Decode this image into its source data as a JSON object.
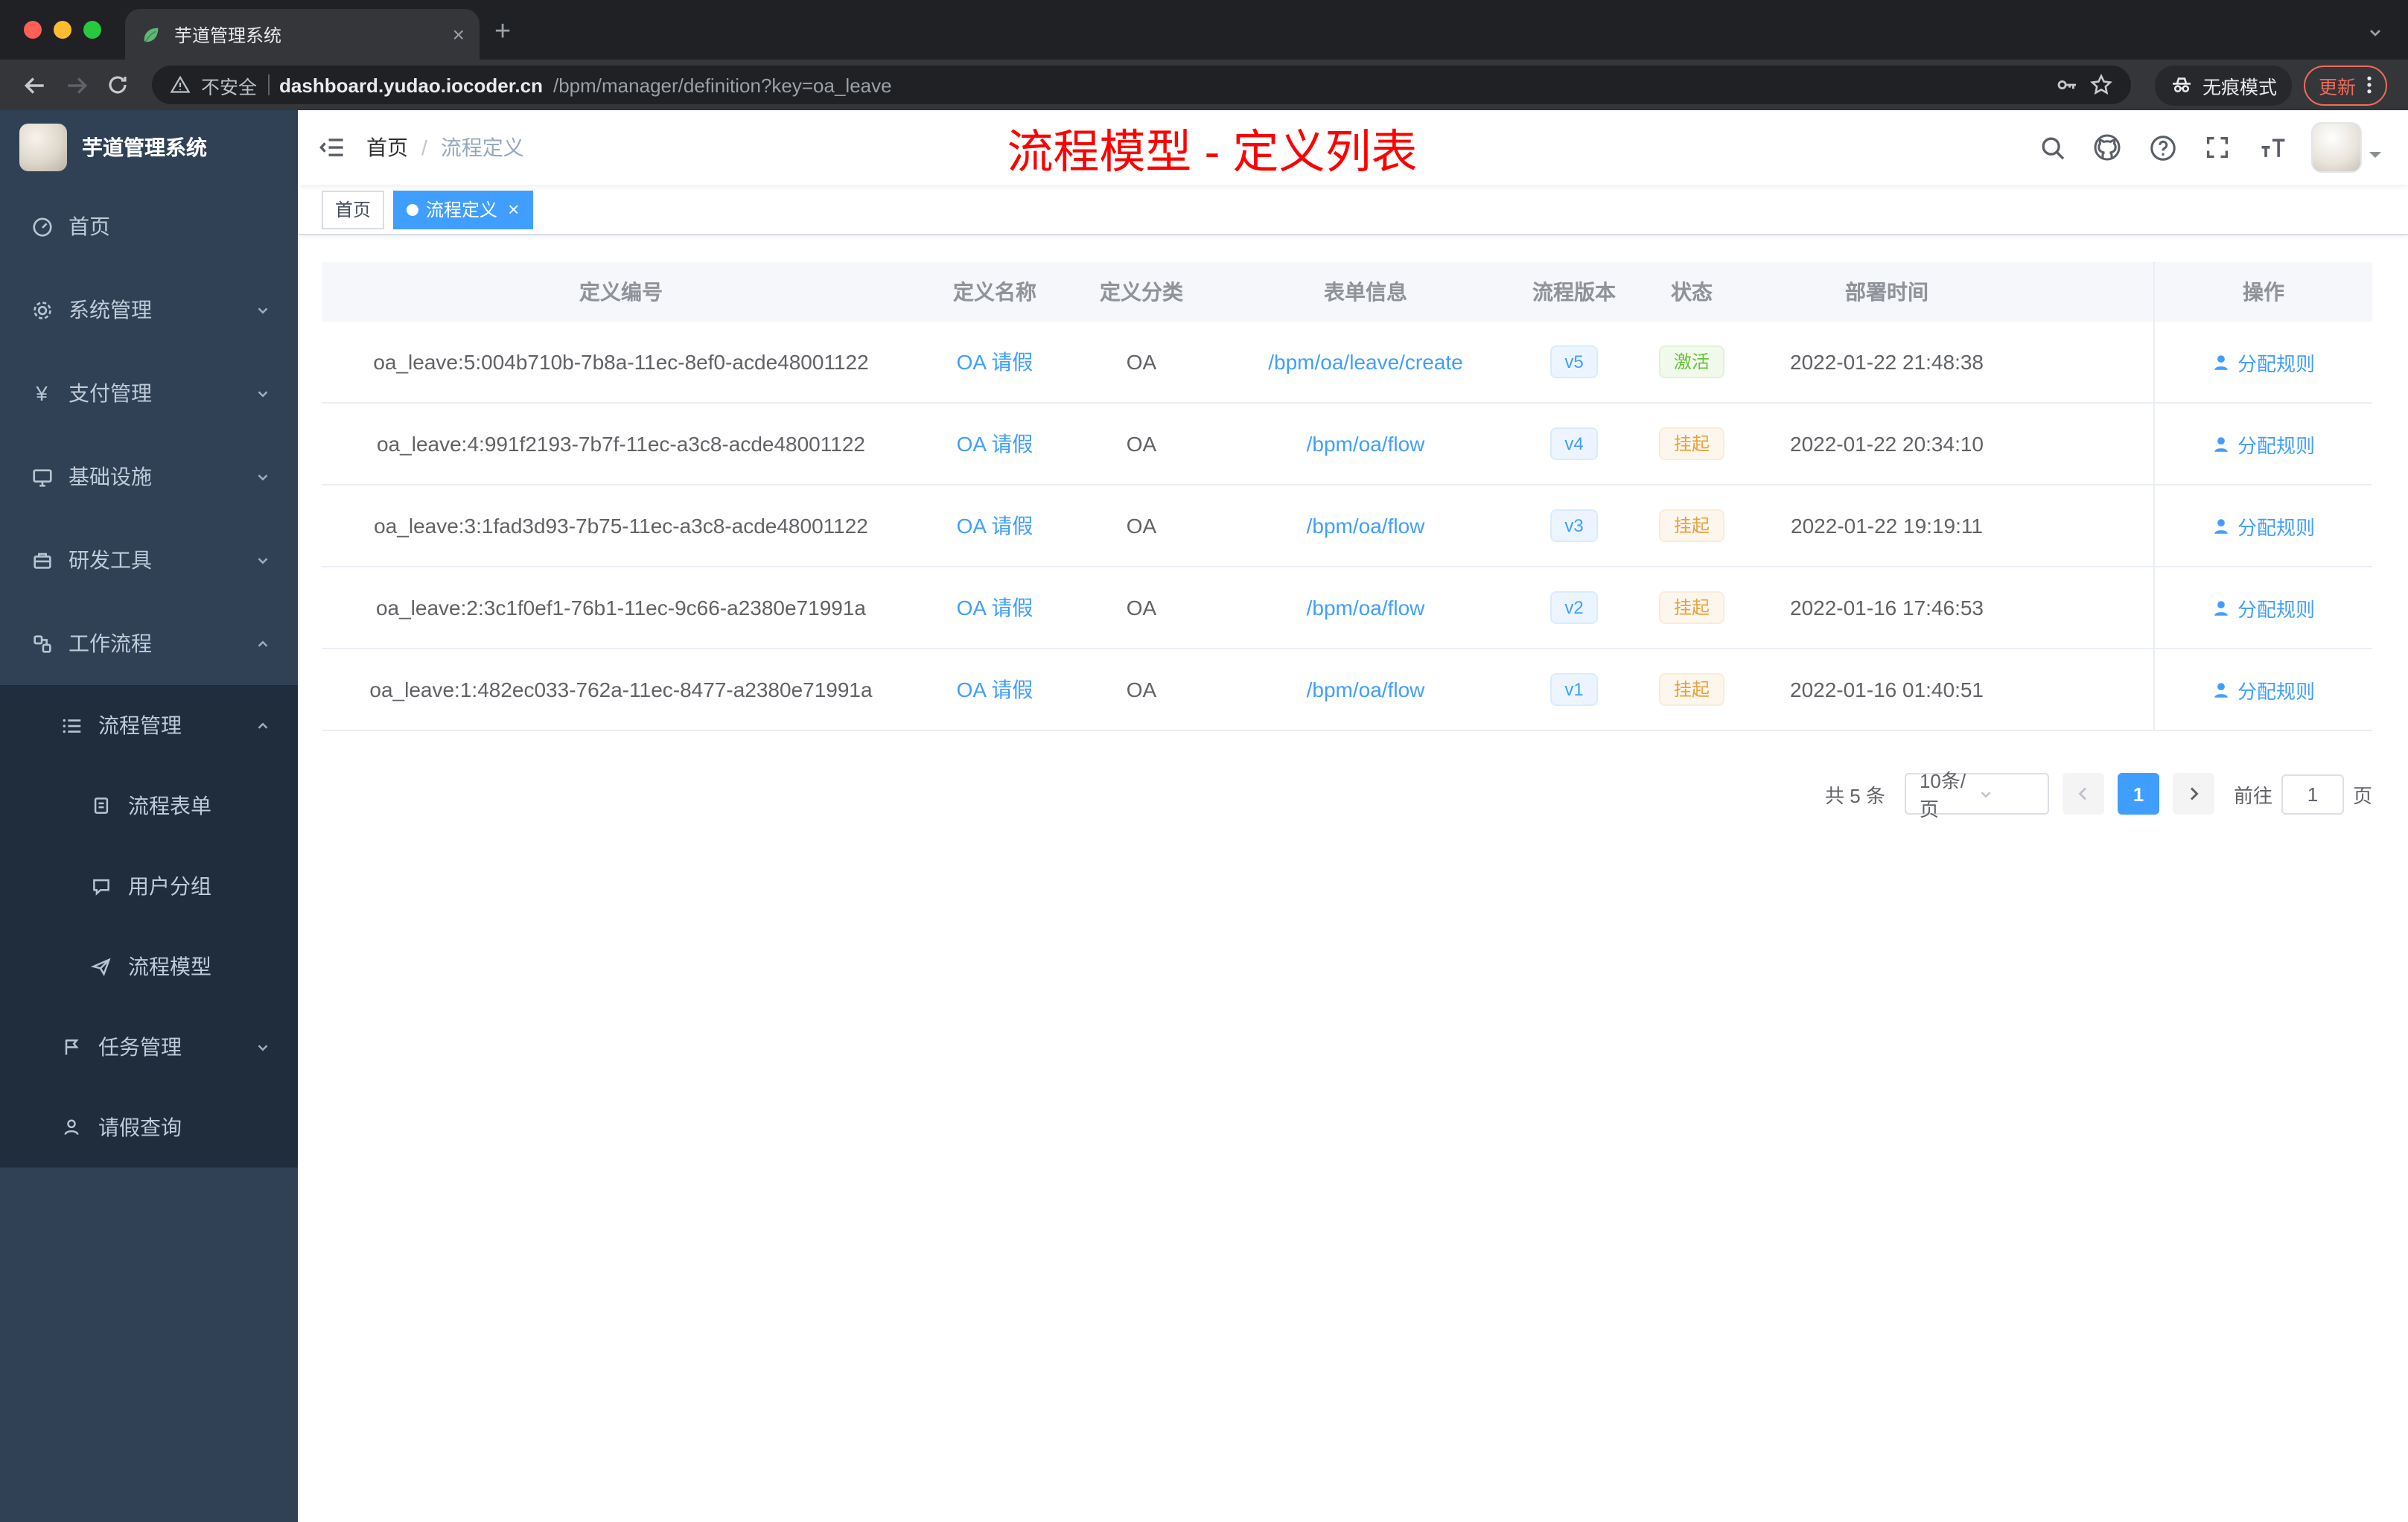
{
  "colors": {
    "accent": "#409eff",
    "annotation": "#fe0000",
    "success": "#67c23a",
    "warning": "#e6a23c",
    "sidebar_bg": "#304156",
    "submenu_bg": "#1f2d3d"
  },
  "icons": {
    "close": "×",
    "new_tab": "+",
    "yen": "¥"
  },
  "browser": {
    "tab_title": "芋道管理系统",
    "security_label": "不安全",
    "url_host": "dashboard.yudao.iocoder.cn",
    "url_path": "/bpm/manager/definition?key=oa_leave",
    "incognito_label": "无痕模式",
    "update_label": "更新"
  },
  "sidebar": {
    "title": "芋道管理系统",
    "items": [
      {
        "label": "首页"
      },
      {
        "label": "系统管理"
      },
      {
        "label": "支付管理"
      },
      {
        "label": "基础设施"
      },
      {
        "label": "研发工具"
      },
      {
        "label": "工作流程"
      },
      {
        "label": "流程管理"
      },
      {
        "label": "流程表单"
      },
      {
        "label": "用户分组"
      },
      {
        "label": "流程模型"
      },
      {
        "label": "任务管理"
      },
      {
        "label": "请假查询"
      }
    ]
  },
  "header": {
    "breadcrumb_home": "首页",
    "breadcrumb_separator": "/",
    "breadcrumb_current": "流程定义",
    "annotation": "流程模型 - 定义列表"
  },
  "tags": {
    "home": "首页",
    "current": "流程定义"
  },
  "table": {
    "columns": [
      "定义编号",
      "定义名称",
      "定义分类",
      "表单信息",
      "流程版本",
      "状态",
      "部署时间",
      "操作"
    ],
    "rows": [
      {
        "id": "oa_leave:5:004b710b-7b8a-11ec-8ef0-acde48001122",
        "name": "OA 请假",
        "category": "OA",
        "form": "/bpm/oa/leave/create",
        "version": "v5",
        "status": "激活",
        "time": "2022-01-22 21:48:38",
        "action": "分配规则"
      },
      {
        "id": "oa_leave:4:991f2193-7b7f-11ec-a3c8-acde48001122",
        "name": "OA 请假",
        "category": "OA",
        "form": "/bpm/oa/flow",
        "version": "v4",
        "status": "挂起",
        "time": "2022-01-22 20:34:10",
        "action": "分配规则"
      },
      {
        "id": "oa_leave:3:1fad3d93-7b75-11ec-a3c8-acde48001122",
        "name": "OA 请假",
        "category": "OA",
        "form": "/bpm/oa/flow",
        "version": "v3",
        "status": "挂起",
        "time": "2022-01-22 19:19:11",
        "action": "分配规则"
      },
      {
        "id": "oa_leave:2:3c1f0ef1-76b1-11ec-9c66-a2380e71991a",
        "name": "OA 请假",
        "category": "OA",
        "form": "/bpm/oa/flow",
        "version": "v2",
        "status": "挂起",
        "time": "2022-01-16 17:46:53",
        "action": "分配规则"
      },
      {
        "id": "oa_leave:1:482ec033-762a-11ec-8477-a2380e71991a",
        "name": "OA 请假",
        "category": "OA",
        "form": "/bpm/oa/flow",
        "version": "v1",
        "status": "挂起",
        "time": "2022-01-16 01:40:51",
        "action": "分配规则"
      }
    ]
  },
  "pagination": {
    "total": "共 5 条",
    "page_size": "10条/页",
    "page": "1",
    "goto_label": "前往",
    "goto_value": "1",
    "unit": "页"
  }
}
